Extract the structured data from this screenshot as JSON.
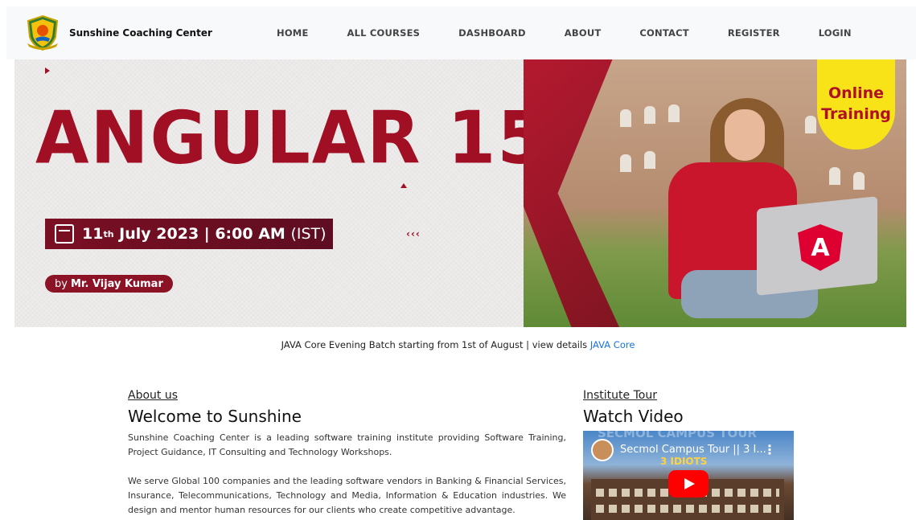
{
  "brand": {
    "name": "Sunshine Coaching Center",
    "logo_icon": "shield-crest-icon"
  },
  "nav": {
    "items": [
      "HOME",
      "ALL COURSES",
      "DASHBOARD",
      "ABOUT",
      "CONTACT",
      "REGISTER",
      "LOGIN"
    ]
  },
  "banner": {
    "title": "ANGULAR 15",
    "date_day": "11",
    "date_suffix": "th",
    "date_rest": "July 2023 | 6:00 AM",
    "timezone": "(IST)",
    "by_prefix": "by",
    "by_name": "Mr. Vijay Kumar",
    "badge_line1": "Online",
    "badge_line2": "Training",
    "logo_letter": "A"
  },
  "notice": {
    "text": "JAVA Core Evening Batch starting from 1st of August | view details",
    "link": "JAVA Core"
  },
  "about": {
    "label": "About us",
    "title": "Welcome to Sunshine",
    "para1": "Sunshine Coaching Center is a leading software training institute providing Software Training, Project Guidance, IT Consulting and Technology Workshops.",
    "para2": "We serve Global 100 companies and the leading software vendors in Banking & Financial Services, Insurance, Telecommunications, Technology and Media, Information & Education industries. We design and mentor human resources for our clients who create competitive advantage."
  },
  "tour": {
    "label": "Institute Tour",
    "title": "Watch Video",
    "video_title": "Secmol Campus Tour || 3 I...",
    "video_sub": "3 IDIOTS",
    "video_ghost": "SECMOL CAMPUS TOUR"
  },
  "colors": {
    "brand_red": "#a10f24",
    "badge_yellow": "#f7e318",
    "link_blue": "#1a73e8",
    "nav_bg": "#f8f9fa"
  }
}
